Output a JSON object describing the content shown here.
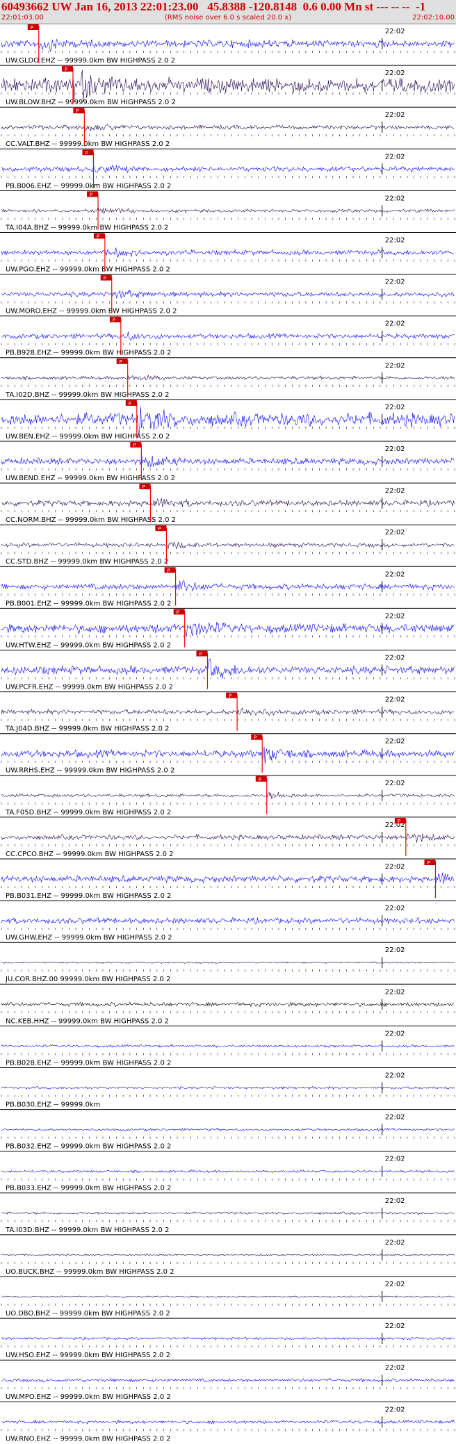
{
  "header": {
    "title": "60493662 UW Jan 16, 2013 22:01:23.00   45.8388 -120.8148  0.6 0.00 Mn st --- -- --  -1",
    "subtitle": "(RMS noise over 6.0 s scaled 20.0 x)",
    "start_time": "22:01:03.00",
    "end_time": "22:02:10.00"
  },
  "tick_label": "22:02",
  "pick_label": "P",
  "colors": {
    "header_bg": "#e0e0e0",
    "header_text": "#d00000",
    "trace_blue": "#0000ff",
    "trace_dark": "#200050",
    "trace_black": "#000000",
    "pick_red": "#ff0000",
    "pick_box": "#cc0000"
  },
  "traces": [
    {
      "label": "UW.GLDO.EHZ -- 99999.0km BW  HIGHPASS  2.0  2",
      "color": "blue",
      "amp": 0.45,
      "pick": 0.085
    },
    {
      "label": "UW.BLOW.BHZ -- 99999.0km BW  HIGHPASS  2.0  2",
      "color": "dark",
      "amp": 0.9,
      "pick": 0.16
    },
    {
      "label": "CC.VALT.BHZ -- 99999.0km BW  HIGHPASS  2.0  2",
      "color": "dark",
      "amp": 0.25,
      "pick": 0.185
    },
    {
      "label": "PB.B006.EHZ -- 99999.0km BW  HIGHPASS  2.0  2",
      "color": "blue",
      "amp": 0.3,
      "pick": 0.205
    },
    {
      "label": "TA.I04A.BHZ -- 99999.0km BW  HIGHPASS  2.0  2",
      "color": "dark",
      "amp": 0.2,
      "pick": 0.215
    },
    {
      "label": "UW.PGO.EHZ -- 99999.0km BW  HIGHPASS  2.0  2",
      "color": "blue",
      "amp": 0.3,
      "pick": 0.23
    },
    {
      "label": "UW.MORO.EHZ -- 99999.0km BW  HIGHPASS  2.0  2",
      "color": "blue",
      "amp": 0.3,
      "pick": 0.245
    },
    {
      "label": "PB.B928.EHZ -- 99999.0km BW  HIGHPASS  2.0  2",
      "color": "blue",
      "amp": 0.3,
      "pick": 0.265
    },
    {
      "label": "TA.I02D.BHZ -- 99999.0km BW  HIGHPASS  2.0  2",
      "color": "dark",
      "amp": 0.2,
      "pick": 0.28
    },
    {
      "label": "UW.BEN.EHZ -- 99999.0km BW  HIGHPASS  2.0  2",
      "color": "blue",
      "amp": 0.8,
      "pick": 0.3
    },
    {
      "label": "UW.BEND.EHZ -- 99999.0km BW  HIGHPASS  2.0  2",
      "color": "blue",
      "amp": 0.4,
      "pick": 0.31
    },
    {
      "label": "CC.NORM.BHZ -- 99999.0km BW  HIGHPASS  2.0  2",
      "color": "dark",
      "amp": 0.35,
      "pick": 0.33
    },
    {
      "label": "CC.STD.BHZ -- 99999.0km BW  HIGHPASS  2.0  2",
      "color": "dark",
      "amp": 0.25,
      "pick": 0.365
    },
    {
      "label": "PB.B001.EHZ -- 99999.0km BW  HIGHPASS  2.0  2",
      "color": "blue",
      "amp": 0.35,
      "pick": 0.385
    },
    {
      "label": "UW.HTW.EHZ -- 99999.0km BW  HIGHPASS  2.0  2",
      "color": "blue",
      "amp": 0.55,
      "pick": 0.405
    },
    {
      "label": "UW.PCFR.EHZ -- 99999.0km BW  HIGHPASS  2.0  2",
      "color": "blue",
      "amp": 0.5,
      "pick": 0.455
    },
    {
      "label": "TA.J04D.BHZ -- 99999.0km BW  HIGHPASS  2.0  2",
      "color": "dark",
      "amp": 0.3,
      "pick": 0.52
    },
    {
      "label": "UW.RRHS.EHZ -- 99999.0km BW  HIGHPASS  2.0  2",
      "color": "blue",
      "amp": 0.45,
      "pick": 0.575
    },
    {
      "label": "TA.F05D.BHZ -- 99999.0km BW  HIGHPASS  2.0  2",
      "color": "dark",
      "amp": 0.2,
      "pick": 0.585
    },
    {
      "label": "CC.CPCO.BHZ -- 99999.0km BW  HIGHPASS  2.0  2",
      "color": "dark",
      "amp": 0.3,
      "pick": 0.89
    },
    {
      "label": "PB.B031.EHZ -- 99999.0km BW  HIGHPASS  2.0  2",
      "color": "blue",
      "amp": 0.4,
      "pick": 0.955
    },
    {
      "label": "UW.GHW.EHZ -- 99999.0km BW  HIGHPASS  2.0  2",
      "color": "blue",
      "amp": 0.35,
      "pick": null
    },
    {
      "label": "JU.COR.BHZ.00 99999.0km BW  HIGHPASS  2.0  2",
      "color": "dark",
      "amp": 0.1,
      "pick": null
    },
    {
      "label": "NC.KEB.HHZ -- 99999.0km BW  HIGHPASS  2.0  2",
      "color": "black",
      "amp": 0.25,
      "pick": null
    },
    {
      "label": "PB.B028.EHZ -- 99999.0km BW  HIGHPASS  2.0  2",
      "color": "blue",
      "amp": 0.15,
      "pick": null
    },
    {
      "label": "PB.B030.EHZ -- 99999.0km",
      "color": "blue",
      "amp": 0.15,
      "pick": null
    },
    {
      "label": "PB.B032.EHZ -- 99999.0km BW  HIGHPASS  2.0  2",
      "color": "blue",
      "amp": 0.15,
      "pick": null
    },
    {
      "label": "PB.B033.EHZ -- 99999.0km BW  HIGHPASS  2.0  2",
      "color": "blue",
      "amp": 0.15,
      "pick": null
    },
    {
      "label": "TA.I03D.BHZ -- 99999.0km BW  HIGHPASS  2.0  2",
      "color": "dark",
      "amp": 0.15,
      "pick": null
    },
    {
      "label": "UO.BUCK.BHZ -- 99999.0km BW  HIGHPASS  2.0  2",
      "color": "dark",
      "amp": 0.1,
      "pick": null
    },
    {
      "label": "UO.DBO.BHZ -- 99999.0km BW  HIGHPASS  2.0  2",
      "color": "dark",
      "amp": 0.1,
      "pick": null
    },
    {
      "label": "UW.HSO.EHZ -- 99999.0km BW  HIGHPASS  2.0  2",
      "color": "blue",
      "amp": 0.15,
      "pick": null
    },
    {
      "label": "UW.MPO.EHZ -- 99999.0km BW  HIGHPASS  2.0  2",
      "color": "blue",
      "amp": 0.2,
      "pick": null
    },
    {
      "label": "UW.RNO.EHZ -- 99999.0km BW  HIGHPASS  2.0  2",
      "color": "blue",
      "amp": 0.2,
      "pick": null
    }
  ]
}
